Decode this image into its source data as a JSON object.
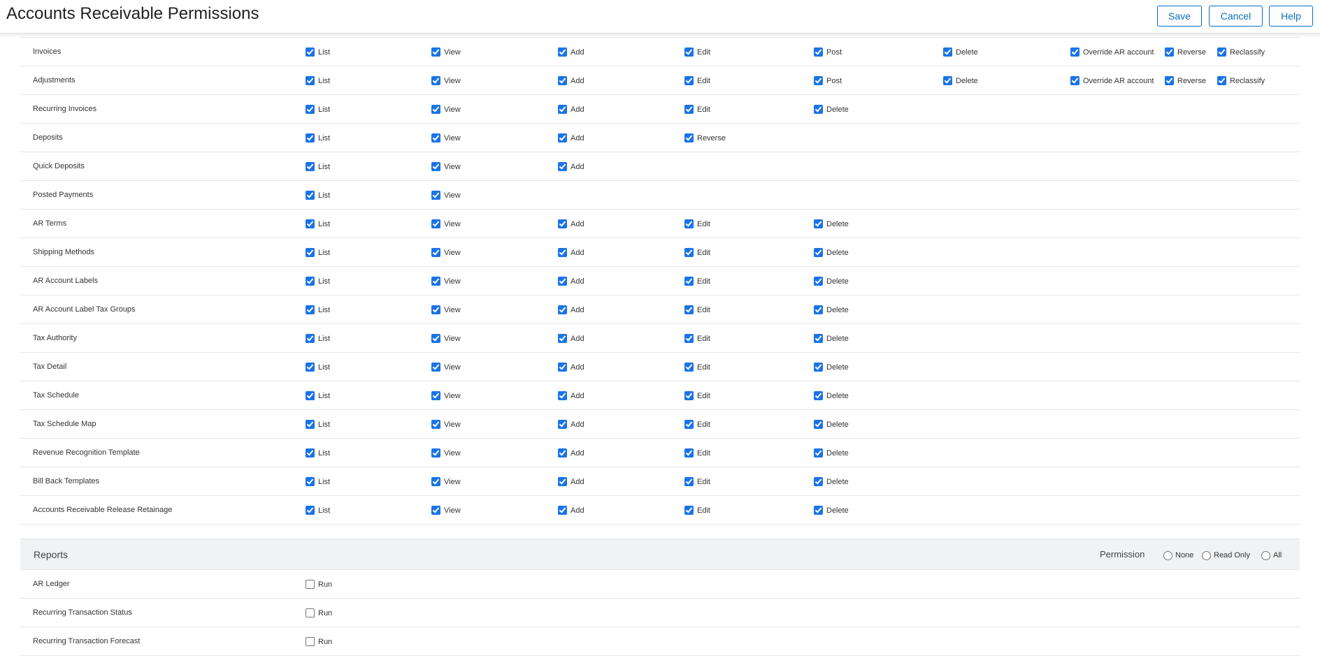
{
  "header": {
    "title": "Accounts Receivable Permissions",
    "buttons": {
      "save": "Save",
      "cancel": "Cancel",
      "help": "Help"
    }
  },
  "colors": {
    "accent": "#0a6ebd",
    "checkbox": "#1a73e8",
    "divider": "#e3e5e7",
    "section_bg": "#f0f2f3"
  },
  "permissions": [
    {
      "name": "Invoices",
      "items": [
        {
          "label": "List",
          "checked": true
        },
        {
          "label": "View",
          "checked": true
        },
        {
          "label": "Add",
          "checked": true
        },
        {
          "label": "Edit",
          "checked": true
        },
        {
          "label": "Post",
          "checked": true
        },
        {
          "label": "Delete",
          "checked": true
        },
        {
          "label": "Override AR account",
          "checked": true
        },
        {
          "label": "Reverse",
          "checked": true
        },
        {
          "label": "Reclassify",
          "checked": true
        }
      ]
    },
    {
      "name": "Adjustments",
      "items": [
        {
          "label": "List",
          "checked": true
        },
        {
          "label": "View",
          "checked": true
        },
        {
          "label": "Add",
          "checked": true
        },
        {
          "label": "Edit",
          "checked": true
        },
        {
          "label": "Post",
          "checked": true
        },
        {
          "label": "Delete",
          "checked": true
        },
        {
          "label": "Override AR account",
          "checked": true
        },
        {
          "label": "Reverse",
          "checked": true
        },
        {
          "label": "Reclassify",
          "checked": true
        }
      ]
    },
    {
      "name": "Recurring Invoices",
      "items": [
        {
          "label": "List",
          "checked": true
        },
        {
          "label": "View",
          "checked": true
        },
        {
          "label": "Add",
          "checked": true
        },
        {
          "label": "Edit",
          "checked": true
        },
        {
          "label": "Delete",
          "checked": true
        }
      ]
    },
    {
      "name": "Deposits",
      "items": [
        {
          "label": "List",
          "checked": true
        },
        {
          "label": "View",
          "checked": true
        },
        {
          "label": "Add",
          "checked": true
        },
        {
          "label": "Reverse",
          "checked": true
        }
      ]
    },
    {
      "name": "Quick Deposits",
      "items": [
        {
          "label": "List",
          "checked": true
        },
        {
          "label": "View",
          "checked": true
        },
        {
          "label": "Add",
          "checked": true
        }
      ]
    },
    {
      "name": "Posted Payments",
      "items": [
        {
          "label": "List",
          "checked": true
        },
        {
          "label": "View",
          "checked": true
        }
      ]
    },
    {
      "name": "AR Terms",
      "items": [
        {
          "label": "List",
          "checked": true
        },
        {
          "label": "View",
          "checked": true
        },
        {
          "label": "Add",
          "checked": true
        },
        {
          "label": "Edit",
          "checked": true
        },
        {
          "label": "Delete",
          "checked": true
        }
      ]
    },
    {
      "name": "Shipping Methods",
      "items": [
        {
          "label": "List",
          "checked": true
        },
        {
          "label": "View",
          "checked": true
        },
        {
          "label": "Add",
          "checked": true
        },
        {
          "label": "Edit",
          "checked": true
        },
        {
          "label": "Delete",
          "checked": true
        }
      ]
    },
    {
      "name": "AR Account Labels",
      "items": [
        {
          "label": "List",
          "checked": true
        },
        {
          "label": "View",
          "checked": true
        },
        {
          "label": "Add",
          "checked": true
        },
        {
          "label": "Edit",
          "checked": true
        },
        {
          "label": "Delete",
          "checked": true
        }
      ]
    },
    {
      "name": "AR Account Label Tax Groups",
      "items": [
        {
          "label": "List",
          "checked": true
        },
        {
          "label": "View",
          "checked": true
        },
        {
          "label": "Add",
          "checked": true
        },
        {
          "label": "Edit",
          "checked": true
        },
        {
          "label": "Delete",
          "checked": true
        }
      ]
    },
    {
      "name": "Tax Authority",
      "items": [
        {
          "label": "List",
          "checked": true
        },
        {
          "label": "View",
          "checked": true
        },
        {
          "label": "Add",
          "checked": true
        },
        {
          "label": "Edit",
          "checked": true
        },
        {
          "label": "Delete",
          "checked": true
        }
      ]
    },
    {
      "name": "Tax Detail",
      "items": [
        {
          "label": "List",
          "checked": true
        },
        {
          "label": "View",
          "checked": true
        },
        {
          "label": "Add",
          "checked": true
        },
        {
          "label": "Edit",
          "checked": true
        },
        {
          "label": "Delete",
          "checked": true
        }
      ]
    },
    {
      "name": "Tax Schedule",
      "items": [
        {
          "label": "List",
          "checked": true
        },
        {
          "label": "View",
          "checked": true
        },
        {
          "label": "Add",
          "checked": true
        },
        {
          "label": "Edit",
          "checked": true
        },
        {
          "label": "Delete",
          "checked": true
        }
      ]
    },
    {
      "name": "Tax Schedule Map",
      "items": [
        {
          "label": "List",
          "checked": true
        },
        {
          "label": "View",
          "checked": true
        },
        {
          "label": "Add",
          "checked": true
        },
        {
          "label": "Edit",
          "checked": true
        },
        {
          "label": "Delete",
          "checked": true
        }
      ]
    },
    {
      "name": "Revenue Recognition Template",
      "items": [
        {
          "label": "List",
          "checked": true
        },
        {
          "label": "View",
          "checked": true
        },
        {
          "label": "Add",
          "checked": true
        },
        {
          "label": "Edit",
          "checked": true
        },
        {
          "label": "Delete",
          "checked": true
        }
      ]
    },
    {
      "name": "Bill Back Templates",
      "items": [
        {
          "label": "List",
          "checked": true
        },
        {
          "label": "View",
          "checked": true
        },
        {
          "label": "Add",
          "checked": true
        },
        {
          "label": "Edit",
          "checked": true
        },
        {
          "label": "Delete",
          "checked": true
        }
      ]
    },
    {
      "name": "Accounts Receivable Release Retainage",
      "items": [
        {
          "label": "List",
          "checked": true
        },
        {
          "label": "View",
          "checked": true
        },
        {
          "label": "Add",
          "checked": true
        },
        {
          "label": "Edit",
          "checked": true
        },
        {
          "label": "Delete",
          "checked": true
        }
      ]
    }
  ],
  "reports": {
    "title": "Reports",
    "permission_label": "Permission",
    "options": [
      "None",
      "Read Only",
      "All"
    ],
    "rows": [
      {
        "name": "AR Ledger",
        "items": [
          {
            "label": "Run",
            "checked": false
          }
        ]
      },
      {
        "name": "Recurring Transaction Status",
        "items": [
          {
            "label": "Run",
            "checked": false
          }
        ]
      },
      {
        "name": "Recurring Transaction Forecast",
        "items": [
          {
            "label": "Run",
            "checked": false
          }
        ]
      }
    ]
  }
}
